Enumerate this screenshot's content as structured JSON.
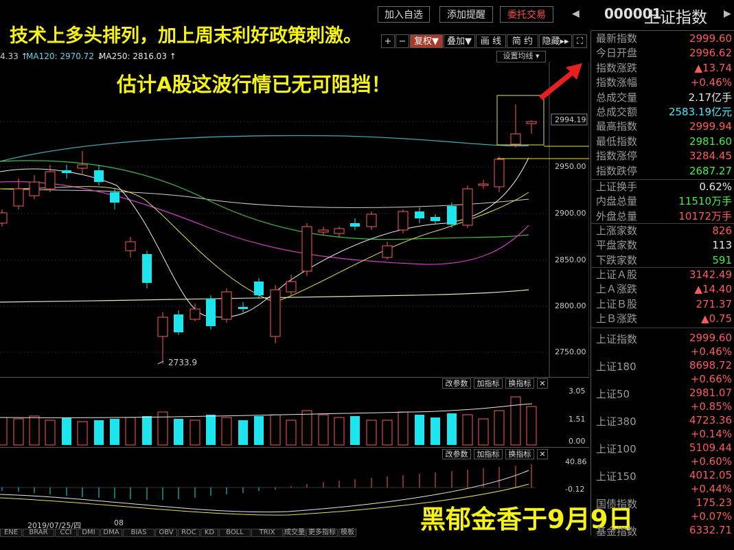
{
  "headline": {
    "line1": "技术上多头排列，加上周末利好政策刺激。",
    "line2": "估计A股这波行情已无可阻挡！",
    "signature": "黑郁金香于9月9日"
  },
  "toolbar": {
    "add_watch": "加入自选",
    "add_alert": "添加提醒",
    "trade": "委托交易"
  },
  "security": {
    "code": "000001",
    "name": "上证指数"
  },
  "chart_toolbar": {
    "plus": "+",
    "minus": "−",
    "adjust": "复权▼",
    "overlay": "叠加▼",
    "draw": "画 线",
    "brief": "简 约",
    "hide": "隐藏▸▸",
    "expand": "⛶"
  },
  "ma_legend": {
    "ma60": "4.33 ↑",
    "ma120": "MA120: 2970.72 ↓",
    "ma250": "MA250: 2816.03 ↑",
    "set_ma": "设置均线 ▾"
  },
  "price_axis": [
    "2950.00",
    "2900.00",
    "2850.00",
    "2800.00",
    "2750.00"
  ],
  "price_tag": "2994.19",
  "low_marker": "2733.9",
  "vol_axis": [
    "3.05",
    "1.51",
    "0.00"
  ],
  "macd_axis": [
    "40.86",
    "-0.12"
  ],
  "sub_btns": {
    "change": "改参数",
    "add": "加指标",
    "swap": "换指标",
    "close": "✕"
  },
  "date_labels": {
    "date": "2019/07/25/四",
    "month": "08"
  },
  "bottom_tabs": [
    "ENE",
    "BRAR",
    "CCI",
    "DMI",
    "DMA",
    "BIAS",
    "OBV",
    "ROC",
    "KD",
    "BOLL",
    "TRIX",
    "成交量",
    "更多指标",
    "模板"
  ],
  "quote": [
    {
      "k": "最新指数",
      "v": "2999.60",
      "c": "red"
    },
    {
      "k": "今日开盘",
      "v": "2996.62",
      "c": "red"
    },
    {
      "k": "指数涨跌",
      "v": "▲13.74",
      "c": "red"
    },
    {
      "k": "指数涨幅",
      "v": "+0.46%",
      "c": "red"
    },
    {
      "k": "总成交量",
      "v": "2.17亿手",
      "c": "wht"
    },
    {
      "k": "总成交额",
      "v": "2583.19亿元",
      "c": "cyan"
    },
    {
      "k": "最高指数",
      "v": "2999.94",
      "c": "red"
    },
    {
      "k": "最低指数",
      "v": "2981.60",
      "c": "grn"
    },
    {
      "k": "指数涨停",
      "v": "3284.45",
      "c": "red"
    },
    {
      "k": "指数跌停",
      "v": "2687.27",
      "c": "grn"
    }
  ],
  "turnover": [
    {
      "k": "上证换手",
      "v": "0.62%",
      "c": "wht"
    },
    {
      "k": "内盘总量",
      "v": "11510万手",
      "c": "grn"
    },
    {
      "k": "外盘总量",
      "v": "10172万手",
      "c": "red"
    }
  ],
  "breadth": [
    {
      "k": "上涨家数",
      "v": "826",
      "c": "red"
    },
    {
      "k": "平盘家数",
      "v": "113",
      "c": "wht"
    },
    {
      "k": "下跌家数",
      "v": "591",
      "c": "grn"
    }
  ],
  "ab": [
    {
      "k": "上证Ａ股",
      "v": "3142.49",
      "c": "red"
    },
    {
      "k": "上Ａ涨跌",
      "v": "▲14.40",
      "c": "red"
    },
    {
      "k": "上证Ｂ股",
      "v": "271.37",
      "c": "red"
    },
    {
      "k": "上Ｂ涨跌",
      "v": "▲0.75",
      "c": "red"
    }
  ],
  "indices": [
    {
      "k": "上证指数",
      "v": "2999.60",
      "c": "+0.46%"
    },
    {
      "k": "上证180",
      "v": "8698.72",
      "c": "+0.66%"
    },
    {
      "k": "上证50",
      "v": "2981.07",
      "c": "+0.85%"
    },
    {
      "k": "上证380",
      "v": "4723.36",
      "c": "+0.14%"
    },
    {
      "k": "上证100",
      "v": "5109.44",
      "c": "+0.60%"
    },
    {
      "k": "上证150",
      "v": "4012.05",
      "c": "+0.44%"
    },
    {
      "k": "国债指数",
      "v": "175.23",
      "c": "+0.07%"
    },
    {
      "k": "基金指数",
      "v": "6332.71",
      "c": ""
    }
  ],
  "colors": {
    "up": "#ff5a5a",
    "down": "#1ee4ee",
    "headline": "#f5f214",
    "accent_red": "#e82020"
  }
}
